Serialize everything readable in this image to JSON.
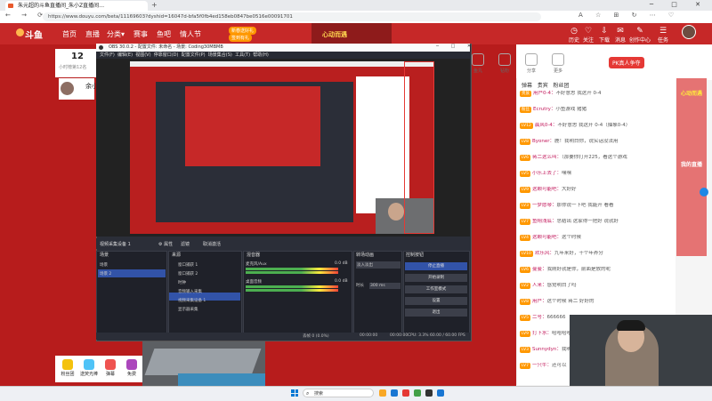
{
  "browser": {
    "tab_title": "朱元超的斗鱼直播间_朱小Z直播间…",
    "new_tab": "+",
    "window_controls": "─ □ ✕",
    "nav": "← → ⟳",
    "url": "https://www.douyu.com/beta/11169603?dyshid=16047d-bfa5f0fb4ed158eb0847be0516e00091701",
    "toolbar_icons": "A ☆ ⊞ ↻ ⋯ ♡"
  },
  "douyu": {
    "logo": "斗鱼",
    "nav": [
      "首页",
      "直播",
      "分类▾",
      "赛事",
      "鱼吧",
      "情人节"
    ],
    "nav_badge": "新春送好礼",
    "nav_badge2": "签到有礼",
    "banner": "心动而遇",
    "header_icons": [
      {
        "label": "历史",
        "glyph": "◷"
      },
      {
        "label": "关注",
        "glyph": "♡"
      },
      {
        "label": "下载",
        "glyph": "⇩"
      },
      {
        "label": "消息",
        "glyph": "✉"
      },
      {
        "label": "创作中心",
        "glyph": "✎"
      },
      {
        "label": "任务",
        "glyph": "☰"
      }
    ],
    "viewers": "12",
    "viewers_label": "小时榜第12名",
    "streamer_name": "余小Z",
    "side_icons": [
      "鱼丸",
      "钻粉",
      "分享",
      "更多"
    ],
    "pk_badge": "PK真人争夺",
    "gifts": [
      "粉丝团",
      "送荧光棒",
      "弹幕",
      "免费"
    ],
    "gift_colors": [
      "#f4c20d",
      "#4fc3f7",
      "#ef5350",
      "#ab47bc"
    ],
    "chat_tabs": [
      "弹幕",
      "贵宾",
      "粉丝团"
    ],
    "chat_lines": [
      {
        "tag": "贵族",
        "nick": "用户0-4：",
        "text": "不好意思 我这开 0-4"
      },
      {
        "tag": "粉丝",
        "nick": "Ecrutry：",
        "text": "小鱼游戏 猪猪"
      },
      {
        "tag": "LV12",
        "nick": "晨风0-4：",
        "text": "不好意思 我这开 0-4（抽象0-4）"
      },
      {
        "tag": "LV8",
        "nick": "Byoner：",
        "text": "鹿！我明白你，说实话没法用"
      },
      {
        "tag": "LV6",
        "nick": "蒋二这么叫：",
        "text": "（那要你打开225，看这个游戏"
      },
      {
        "tag": "LV5",
        "nick": "小乐上去了：",
        "text": "嘿嘿"
      },
      {
        "tag": "LV9",
        "nick": "这颗可能吧：",
        "text": "大好好"
      },
      {
        "tag": "LV3",
        "nick": "一梦愿琴：",
        "text": "那你说一下吧 我能开 看看"
      },
      {
        "tag": "LV7",
        "nick": "鱼翔浅底：",
        "text": "总结出 这家得一把好 说就好"
      },
      {
        "tag": "LV4",
        "nick": "这颗可能吧：",
        "text": "这个时候"
      },
      {
        "tag": "LV10",
        "nick": "欢乐风：",
        "text": "九年来好，十个年养分"
      },
      {
        "tag": "LV6",
        "nick": "曼曼：",
        "text": "我刚好就是你，前面是放的呢"
      },
      {
        "tag": "LV2",
        "nick": "人来：",
        "text": "感觉明白了吗"
      },
      {
        "tag": "LV8",
        "nick": "用户：",
        "text": "这个时候 蒋二 好好的"
      },
      {
        "tag": "LV5",
        "nick": "二号：",
        "text": "666666"
      },
      {
        "tag": "LV9",
        "nick": "打下水：",
        "text": "哈哈哈哈 这个我赞"
      },
      {
        "tag": "LV3",
        "nick": "Sunnydyn：",
        "text": "我明白你，说实话"
      },
      {
        "tag": "LV7",
        "nick": "一只牛：",
        "text": "还可以"
      }
    ],
    "ad_top": "心动而遇",
    "ad_bottom": "我的直播"
  },
  "obs": {
    "title": "OBS 30.0.2 - 配置文件: 未命名 - 场景: Coding30MBMB",
    "window_controls": "─ □ ✕",
    "menu": [
      "文件(F)",
      "编辑(E)",
      "视图(V)",
      "停靠窗口(D)",
      "配置文件(P)",
      "场景集合(S)",
      "工具(T)",
      "帮助(H)"
    ],
    "toolbar": {
      "source": "视频采集设备 1",
      "props": "⚙ 属性",
      "filters": "滤镜",
      "deactivate": "取消激活"
    },
    "docks": {
      "scenes": "场景",
      "sources": "来源",
      "mixer": "混音器",
      "transitions": "转场动画",
      "controls": "控制按钮"
    },
    "scenes": [
      "场景",
      "场景 2"
    ],
    "sources": [
      "窗口捕获 1",
      "窗口捕获 2",
      "时钟",
      "音频输入采集",
      "视频采集设备 1",
      "显示器采集"
    ],
    "mixer": [
      {
        "name": "麦克风/Aux",
        "db": "0.0 dB"
      },
      {
        "name": "桌面音频",
        "db": "0.0 dB"
      }
    ],
    "transition": "淡入淡出",
    "duration_label": "时长",
    "duration": "300 ms",
    "controls": [
      "停止直播",
      "开始录制",
      "工作室模式",
      "设置",
      "退出"
    ],
    "status": {
      "dropped": "丢帧 0 (0.0%)",
      "live": "00:00:00",
      "rec": "00:00:00",
      "cpu": "CPU: 3.3%",
      "fps": "60.00 / 60.00 FPS"
    }
  },
  "taskbar": {
    "search": "搜索",
    "icons": [
      "#f9a825",
      "#1976d2",
      "#e53935",
      "#43a047",
      "#333333",
      "#1976d2"
    ]
  }
}
